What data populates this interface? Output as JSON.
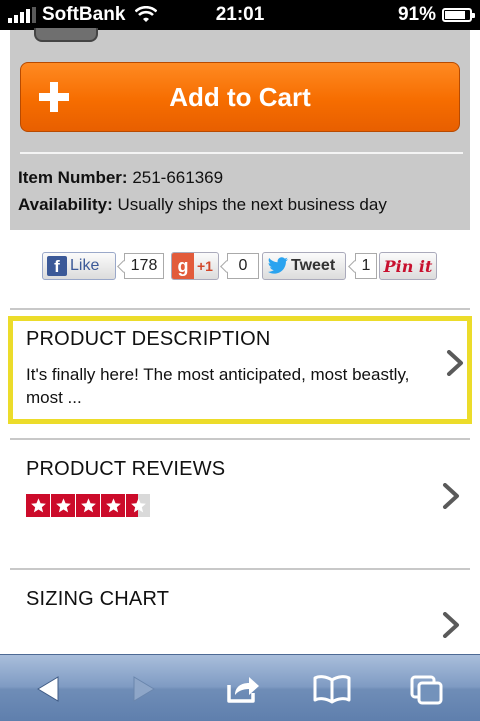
{
  "status_bar": {
    "carrier": "SoftBank",
    "time": "21:01",
    "battery_percent": "91%",
    "battery_level": 0.91
  },
  "product": {
    "add_to_cart_label": "Add to Cart",
    "item_number_label": "Item Number:",
    "item_number_value": "251-661369",
    "availability_label": "Availability:",
    "availability_value": "Usually ships the next business day"
  },
  "social": {
    "like_label": "Like",
    "like_count": "178",
    "gplus_label": "+1",
    "gplus_count": "0",
    "tweet_label": "Tweet",
    "tweet_count": "1",
    "pinit_label": "Pin it"
  },
  "sections": {
    "description_title": "PRODUCT DESCRIPTION",
    "description_text": "It's finally here! The most anticipated, most beastly, most ...",
    "reviews_title": "PRODUCT REVIEWS",
    "rating_stars": 4.5,
    "rating_max": 5,
    "sizing_title": "SIZING CHART"
  },
  "colors": {
    "accent_orange": "#f66d00",
    "highlight_yellow": "#ecdc2a",
    "star_red": "#cc0b2a",
    "toolbar_blue": "#7f9bc3"
  },
  "icons": {
    "back": "back-arrow-icon",
    "forward": "forward-arrow-icon",
    "share": "share-icon",
    "bookmarks": "bookmarks-icon",
    "tabs": "tabs-icon"
  }
}
